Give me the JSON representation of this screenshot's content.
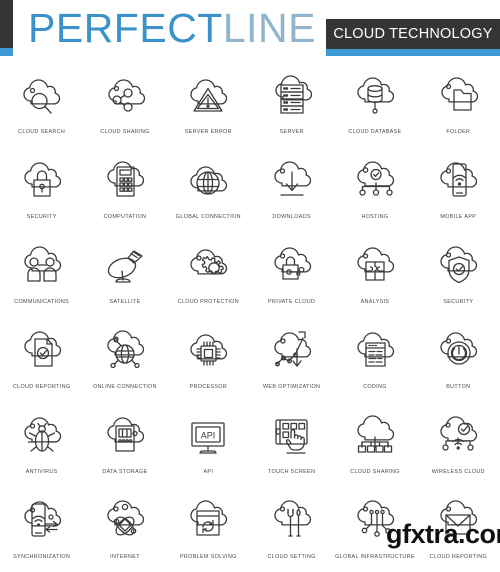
{
  "header": {
    "brand_primary": "PERFECT",
    "brand_secondary": "LINE",
    "category_tag": "CLOUD TECHNOLOGY",
    "accent_color": "#3d99d4",
    "dark_color": "#333536",
    "brand_primary_color": "#3a92c8",
    "brand_secondary_color": "#8fb4cc"
  },
  "watermark": {
    "text": "gfxtra.com"
  },
  "grid": {
    "columns": 6,
    "rows": 6,
    "stroke_color": "#3b3b3b",
    "icons": [
      {
        "label": "CLOUD SEARCH",
        "icon": "cloud-search-icon"
      },
      {
        "label": "CLOUD SHARING",
        "icon": "cloud-sharing-icon"
      },
      {
        "label": "SERVER ERROR",
        "icon": "server-error-icon"
      },
      {
        "label": "SERVER",
        "icon": "server-icon"
      },
      {
        "label": "CLOUD DATABASE",
        "icon": "cloud-database-icon"
      },
      {
        "label": "FOLDER",
        "icon": "cloud-folder-icon"
      },
      {
        "label": "SECURITY",
        "icon": "cloud-lock-security-icon"
      },
      {
        "label": "COMPUTATION",
        "icon": "cloud-calculator-icon"
      },
      {
        "label": "GLOBAL CONNECTION",
        "icon": "cloud-globe-icon"
      },
      {
        "label": "DOWNLOADS",
        "icon": "cloud-download-icon"
      },
      {
        "label": "HOSTING",
        "icon": "cloud-hosting-icon"
      },
      {
        "label": "MOBILE APP",
        "icon": "cloud-mobile-app-icon"
      },
      {
        "label": "COMMUNICATIONS",
        "icon": "cloud-users-icon"
      },
      {
        "label": "SATELLITE",
        "icon": "satellite-dish-icon"
      },
      {
        "label": "CLOUD PROTECTION",
        "icon": "cloud-gear-icon"
      },
      {
        "label": "PRIVATE CLOUD",
        "icon": "cloud-key-lock-icon"
      },
      {
        "label": "ANALYSIS",
        "icon": "cloud-puzzle-icon"
      },
      {
        "label": "SECURITY",
        "icon": "cloud-shield-check-icon"
      },
      {
        "label": "CLOUD REPORTING",
        "icon": "cloud-document-check-icon"
      },
      {
        "label": "ONLINE CONNECTION",
        "icon": "cloud-globe-nodes-icon"
      },
      {
        "label": "PROCESSOR",
        "icon": "cloud-cpu-icon"
      },
      {
        "label": "WEB OPTIMIZATION",
        "icon": "cloud-chart-arrow-icon"
      },
      {
        "label": "CODING",
        "icon": "cloud-code-window-icon"
      },
      {
        "label": "BUTTON",
        "icon": "cloud-power-button-icon"
      },
      {
        "label": "ANTIVIRUS",
        "icon": "cloud-bug-icon"
      },
      {
        "label": "DATA STORAGE",
        "icon": "cloud-data-storage-icon"
      },
      {
        "label": "API",
        "icon": "api-monitor-icon"
      },
      {
        "label": "TOUCH SCREEN",
        "icon": "touch-screen-hand-icon"
      },
      {
        "label": "CLOUD SHARING",
        "icon": "cloud-network-share-icon"
      },
      {
        "label": "WIRELESS CLOUD",
        "icon": "wireless-cloud-check-icon"
      },
      {
        "label": "SYNCHRONIZATION",
        "icon": "cloud-sync-phone-icon"
      },
      {
        "label": "INTERNET",
        "icon": "cloud-atom-internet-icon"
      },
      {
        "label": "PROBLEM SOLVING",
        "icon": "cloud-refresh-window-icon"
      },
      {
        "label": "CLOUD SETTING",
        "icon": "cloud-tools-icon"
      },
      {
        "label": "GLOBAL INFRASTRUCTURE",
        "icon": "cloud-infrastructure-nodes-icon"
      },
      {
        "label": "CLOUD REPORTING",
        "icon": "cloud-envelope-icon"
      }
    ]
  }
}
